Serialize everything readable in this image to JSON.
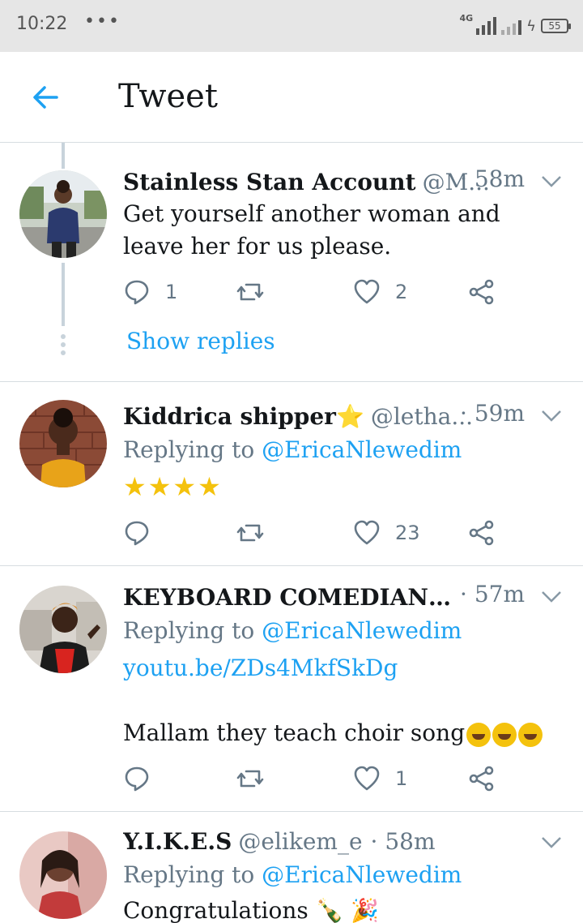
{
  "status_bar": {
    "time": "10:22",
    "dots": "•••",
    "network": "4G",
    "battery": "55"
  },
  "header": {
    "title": "Tweet"
  },
  "tweets": [
    {
      "name": "Stainless Stan Account",
      "handle": "@M...",
      "time": "· 58m",
      "text_line1": "Get yourself another woman and",
      "text_line2": "leave her for us please.",
      "reply_count": "1",
      "retweet_count": "",
      "like_count": "2",
      "show_replies": "Show replies"
    },
    {
      "name": "Kiddrica shipper⭐",
      "handle": "@letha...",
      "time": "· 59m",
      "replying_prefix": "Replying to ",
      "replying_to": "@EricaNlewedim",
      "stars": "★★★★",
      "reply_count": "",
      "retweet_count": "",
      "like_count": "23"
    },
    {
      "name": "KEYBOARD COMEDIAN (...",
      "handle": "",
      "time": "· 57m",
      "replying_prefix": "Replying to ",
      "replying_to": "@EricaNlewedim",
      "link": "youtu.be/ZDs4MkfSkDg",
      "text": "Mallam they teach choir song",
      "reply_count": "",
      "retweet_count": "",
      "like_count": "1"
    },
    {
      "name": "Y.I.K.E.S",
      "handle": "@elikem_e",
      "time": "· 58m",
      "replying_prefix": "Replying to ",
      "replying_to": "@EricaNlewedim",
      "text": "Congratulations 🍾 🎉"
    }
  ],
  "colors": {
    "accent": "#1da1f2",
    "muted": "#657786",
    "divider": "#d7dde1"
  }
}
